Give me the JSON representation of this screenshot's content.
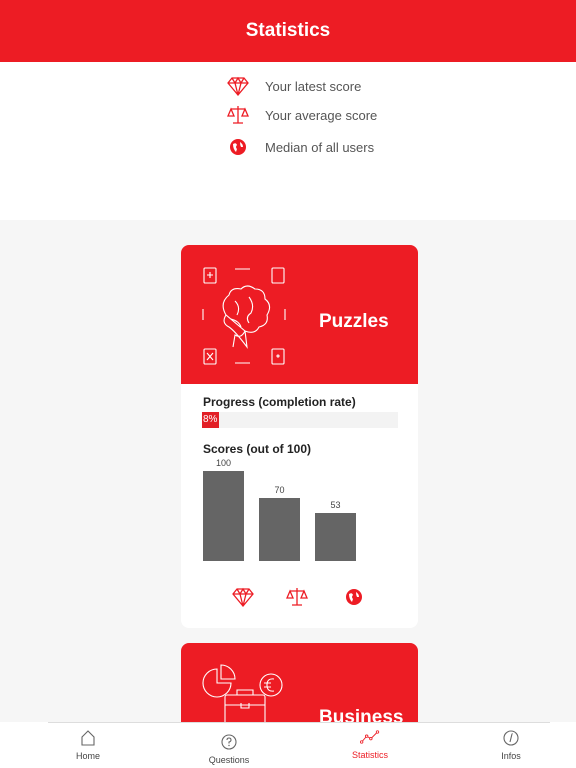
{
  "header": {
    "title": "Statistics"
  },
  "legend": {
    "items": [
      {
        "icon": "diamond-icon",
        "label": "Your latest score"
      },
      {
        "icon": "scales-icon",
        "label": "Your average score"
      },
      {
        "icon": "globe-icon",
        "label": "Median of all users"
      }
    ]
  },
  "cards": [
    {
      "title": "Puzzles",
      "progress_label": "Progress (completion rate)",
      "progress_value": 8,
      "progress_text": "8%",
      "scores_label": "Scores (out of 100)",
      "chart_data": {
        "type": "bar",
        "categories": [
          "Your latest score",
          "Your average score",
          "Median of all users"
        ],
        "values": [
          100,
          70,
          53
        ],
        "value_labels": [
          "100",
          "70",
          "53"
        ],
        "ylim": [
          0,
          100
        ],
        "title": "Scores (out of 100)"
      }
    },
    {
      "title": "Business"
    }
  ],
  "tabbar": {
    "tabs": [
      {
        "label": "Home",
        "icon": "home-icon",
        "active": false
      },
      {
        "label": "Questions",
        "icon": "question-icon",
        "active": false
      },
      {
        "label": "Statistics",
        "icon": "statistics-icon",
        "active": true
      },
      {
        "label": "Infos",
        "icon": "info-icon",
        "active": false
      }
    ]
  },
  "colors": {
    "accent": "#ed1c24",
    "bar": "#656565"
  }
}
